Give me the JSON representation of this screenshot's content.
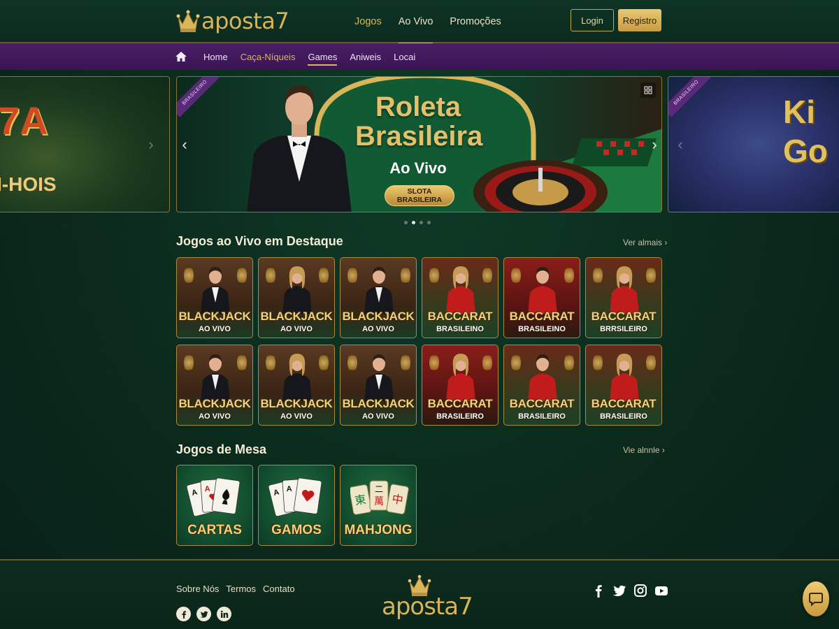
{
  "header": {
    "brand": "aposta7",
    "nav": [
      {
        "label": "Jogos",
        "state": "gold"
      },
      {
        "label": "Ao Vivo",
        "state": "active"
      },
      {
        "label": "Promoções",
        "state": "normal"
      }
    ],
    "login_label": "Login",
    "register_label": "Registro"
  },
  "subnav": {
    "items": [
      {
        "label": "Home"
      },
      {
        "label": "Caça-Níqueis"
      },
      {
        "label": "Games"
      },
      {
        "label": "Aniweis"
      },
      {
        "label": "Locai"
      }
    ]
  },
  "carousel": {
    "left_slide": {
      "title": "7A",
      "subtitle": "I-HOIS"
    },
    "main_slide": {
      "ribbon": "BRASILEIRO",
      "title_line1": "Roleta",
      "title_line2": "Brasileira",
      "subtitle": "Ao Vivo",
      "button": "SLOTA BRASILEIRA"
    },
    "right_slide": {
      "ribbon": "BRASILEIRO",
      "title_line1": "Ki",
      "title_line2": "Go"
    },
    "active_dot": 1,
    "dot_count": 4
  },
  "live_section": {
    "title": "Jogos ao Vivo em Destaque",
    "see_more": "Ver almais",
    "row1": [
      {
        "line1": "BLACKJACK",
        "line2": "AO VIVO",
        "theme": "brown"
      },
      {
        "line1": "BLACKJACK",
        "line2": "AO VIVO",
        "theme": "brown"
      },
      {
        "line1": "BLACKJACK",
        "line2": "AO VIVO",
        "theme": "brown"
      },
      {
        "line1": "BACCARAT",
        "line2": "BRASILEINO",
        "theme": "redgreen"
      },
      {
        "line1": "BACCARAT",
        "line2": "BRASILEINO",
        "theme": "red"
      },
      {
        "line1": "BACCARAT",
        "line2": "BRRSILEIRO",
        "theme": "redgreen"
      }
    ],
    "row2": [
      {
        "line1": "BLACKJACK",
        "line2": "AO VIVO",
        "theme": "brown"
      },
      {
        "line1": "BLACKJACK",
        "line2": "AO VIVO",
        "theme": "brown"
      },
      {
        "line1": "BLACKJACK",
        "line2": "AO VIVO",
        "theme": "brown"
      },
      {
        "line1": "BACCARAT",
        "line2": "BRASILEIRO",
        "theme": "red"
      },
      {
        "line1": "BACCARAT",
        "line2": "BRASILEIRO",
        "theme": "redgreen"
      },
      {
        "line1": "BACCARAT",
        "line2": "BRASILEIRO",
        "theme": "redgreen"
      }
    ]
  },
  "table_section": {
    "title": "Jogos de Mesa",
    "see_more": "Vie alnnle",
    "cards": [
      {
        "label": "CARTAS",
        "icon": "playing-cards-icon"
      },
      {
        "label": "GAMOS",
        "icon": "playing-cards-icon"
      },
      {
        "label": "MAHJONG",
        "icon": "mahjong-tiles-icon",
        "tiles": [
          "東",
          "二\n萬",
          "中"
        ]
      }
    ]
  },
  "footer": {
    "links": [
      "Sobre Nós",
      "Termos",
      "Contato"
    ],
    "brand": "aposta7",
    "social_left": [
      "facebook-icon",
      "twitter-icon",
      "linkedin-icon"
    ],
    "social_right": [
      "facebook-icon",
      "twitter-icon",
      "instagram-icon",
      "youtube-icon"
    ]
  },
  "colors": {
    "background": "#0b2a1c",
    "gold": "#d9b55c",
    "subnav_purple": "#4a1f66",
    "card_border": "#a88a42"
  }
}
